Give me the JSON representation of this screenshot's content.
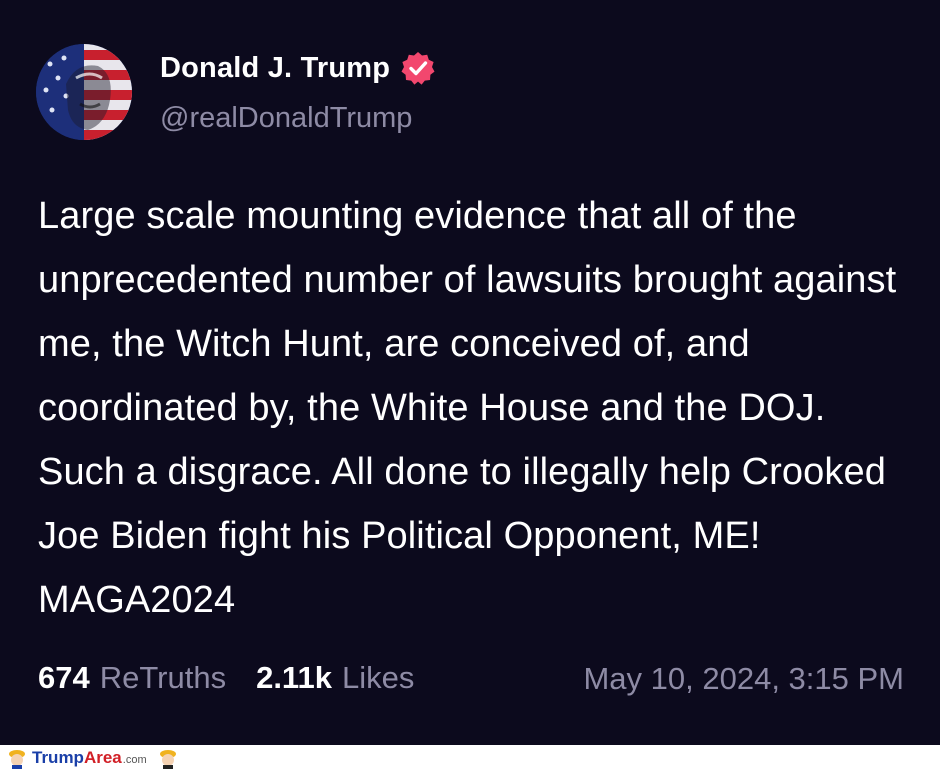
{
  "post": {
    "author": {
      "display_name": "Donald J. Trump",
      "handle": "@realDonaldTrump",
      "verified": true,
      "avatar_icon": "flag-portrait-avatar"
    },
    "text": "Large scale mounting evidence that all of the unprecedented number of lawsuits brought against me, the Witch Hunt, are conceived of, and coordinated by, the White House and the DOJ. Such a disgrace. All done to illegally help Crooked Joe Biden fight his Political Opponent, ME! MAGA2024",
    "stats": {
      "retruths_count": "674",
      "retruths_label": "ReTruths",
      "likes_count": "2.11k",
      "likes_label": "Likes"
    },
    "timestamp": "May 10, 2024, 3:15 PM"
  },
  "footer": {
    "logo_part1": "Trump",
    "logo_part2": "Area",
    "logo_part3": ".com"
  },
  "colors": {
    "background": "#0c0a1d",
    "text_primary": "#ffffff",
    "text_secondary": "#8e8ba5",
    "verified_badge": "#f2476e"
  }
}
